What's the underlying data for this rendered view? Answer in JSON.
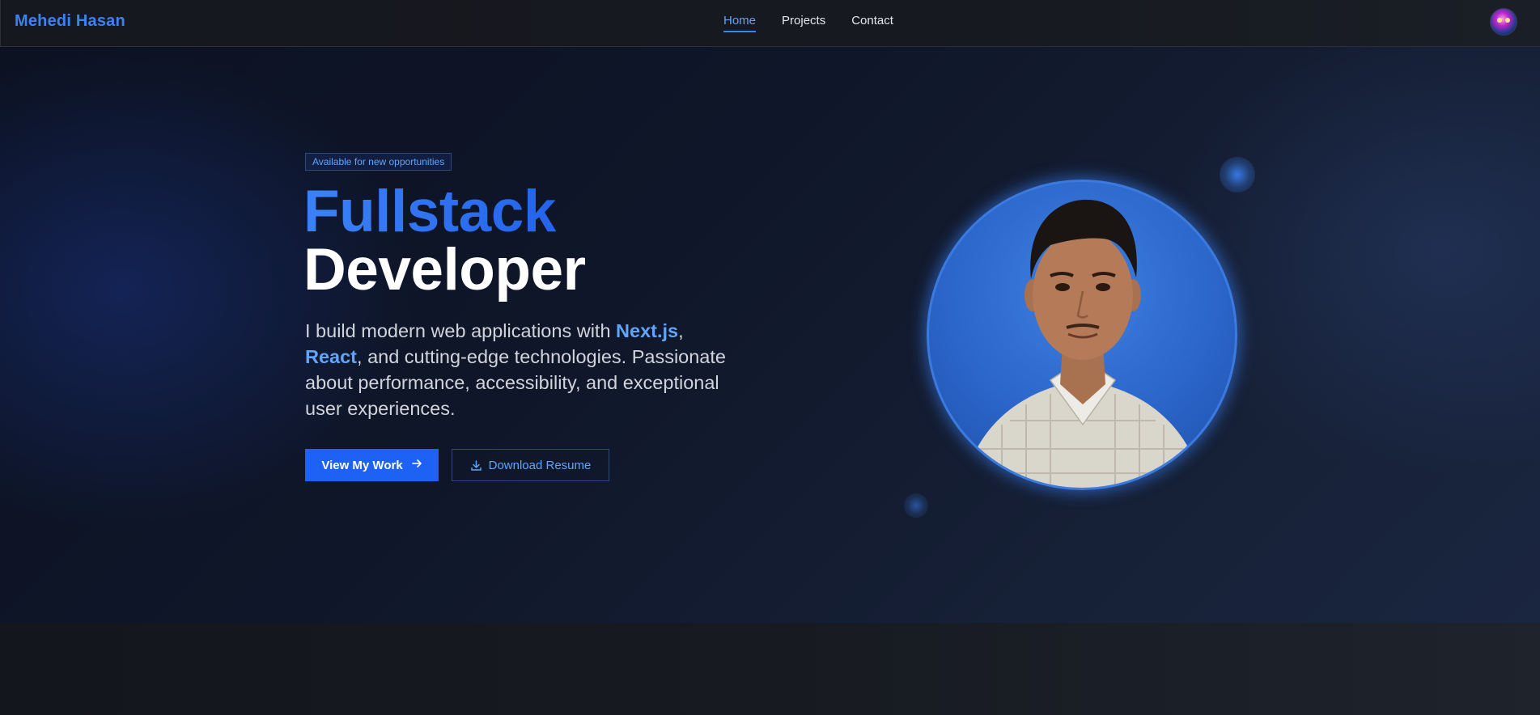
{
  "nav": {
    "brand": "Mehedi Hasan",
    "links": [
      {
        "label": "Home",
        "active": true
      },
      {
        "label": "Projects",
        "active": false
      },
      {
        "label": "Contact",
        "active": false
      }
    ],
    "avatar_icon": "user-avatar"
  },
  "hero": {
    "badge": "Available for new opportunities",
    "title_line1": "Fullstack",
    "title_line2": "Developer",
    "description": {
      "part1": "I build modern web applications with ",
      "highlight1": "Next.js",
      "part2": ",",
      "highlight2": "React",
      "part3": ", and cutting-edge technologies. Passionate about performance, accessibility, and exceptional user experiences."
    },
    "primary_button": "View My Work",
    "primary_button_icon": "arrow-right-icon",
    "secondary_button": "Download Resume",
    "secondary_button_icon": "download-icon",
    "portrait_icon": "profile-photo"
  },
  "colors": {
    "accent": "#3b82f6",
    "primary_button": "#1d62f5",
    "background": "#0f1629"
  }
}
